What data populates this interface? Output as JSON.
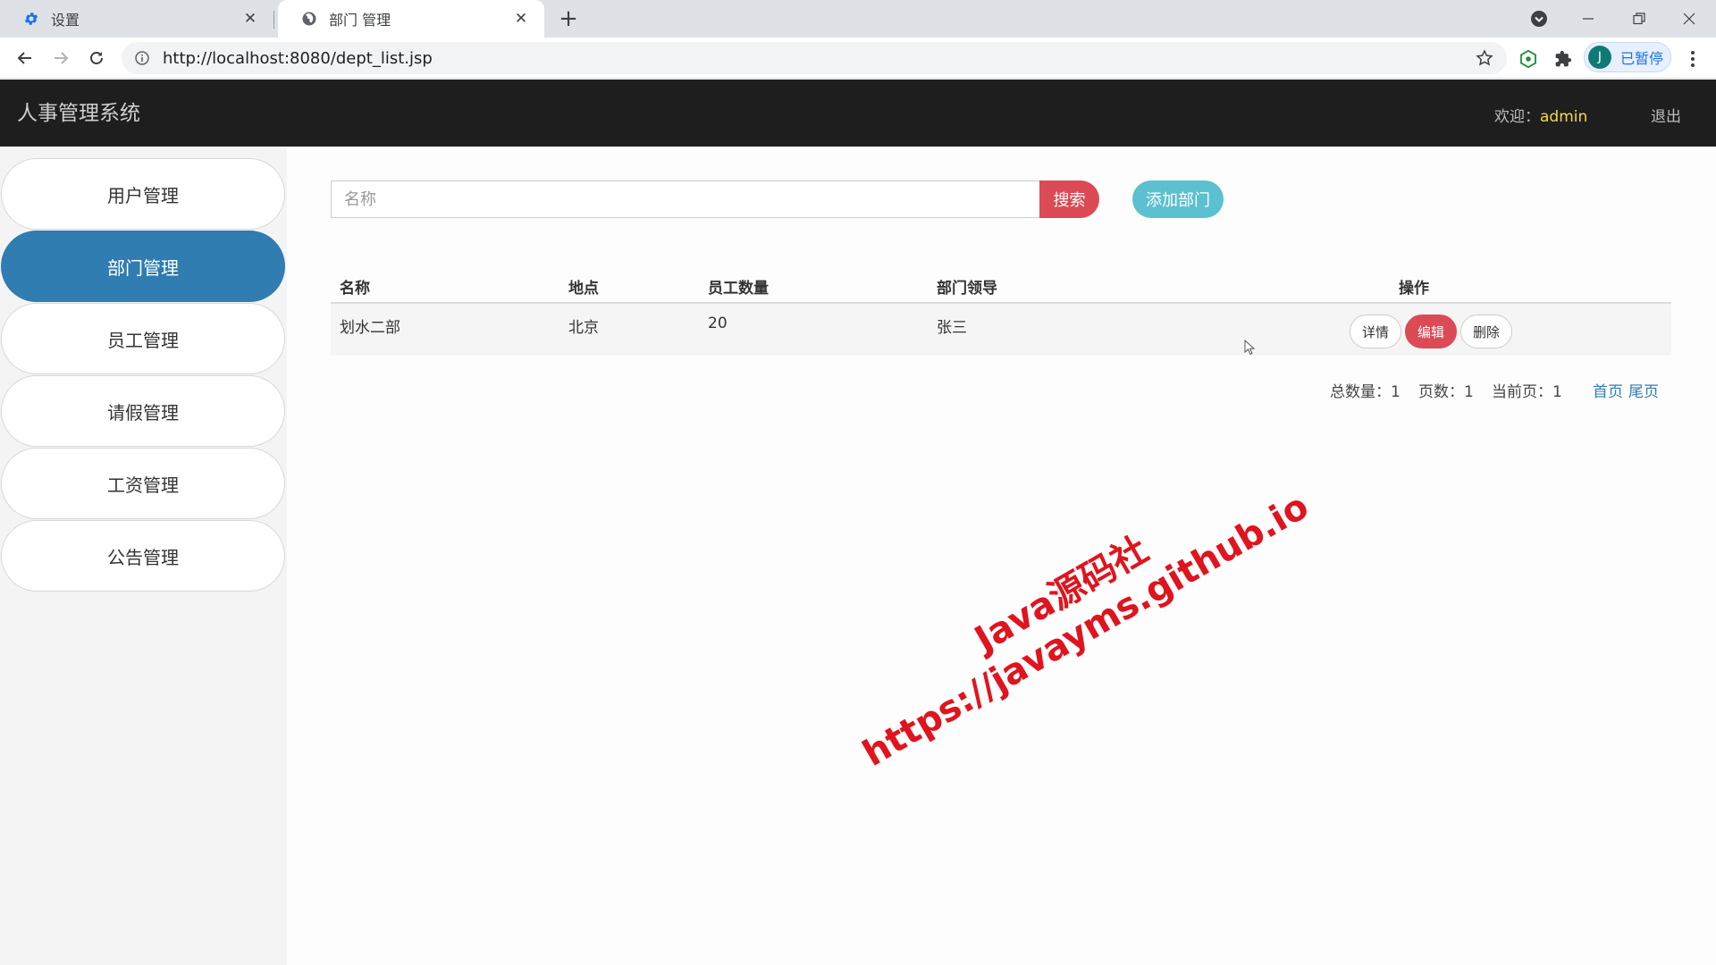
{
  "browser": {
    "tabs": [
      {
        "title": "设置",
        "icon": "gear-icon",
        "active": false
      },
      {
        "title": "部门 管理",
        "icon": "globe-icon",
        "active": true
      }
    ],
    "url": "http://localhost:8080/dept_list.jsp",
    "profile_avatar": "J",
    "profile_status": "已暂停"
  },
  "app": {
    "brand": "人事管理系统",
    "welcome_label": "欢迎：",
    "username": "admin",
    "logout": "退出"
  },
  "sidebar": {
    "items": [
      {
        "label": "用户管理",
        "active": false
      },
      {
        "label": "部门管理",
        "active": true
      },
      {
        "label": "员工管理",
        "active": false
      },
      {
        "label": "请假管理",
        "active": false
      },
      {
        "label": "工资管理",
        "active": false
      },
      {
        "label": "公告管理",
        "active": false
      }
    ]
  },
  "search": {
    "placeholder": "名称",
    "value": "",
    "button": "搜索",
    "add_button": "添加部门"
  },
  "table": {
    "headers": [
      "名称",
      "地点",
      "员工数量",
      "部门领导",
      "操作"
    ],
    "rows": [
      {
        "name": "划水二部",
        "location": "北京",
        "count": "20",
        "leader": "张三",
        "actions": [
          "详情",
          "编辑",
          "删除"
        ]
      }
    ]
  },
  "pagination": {
    "total": "总数量：1",
    "pages": "页数：1",
    "current": "当前页：1",
    "first": "首页",
    "last": "尾页"
  },
  "watermark": {
    "line1": "Java源码社",
    "line2": "https://javayms.github.io"
  },
  "colors": {
    "header_bg": "#1e1e1e",
    "active_nav": "#2f7db1",
    "danger": "#db4a55",
    "info": "#5bc0cf",
    "username": "#f5d94a"
  }
}
